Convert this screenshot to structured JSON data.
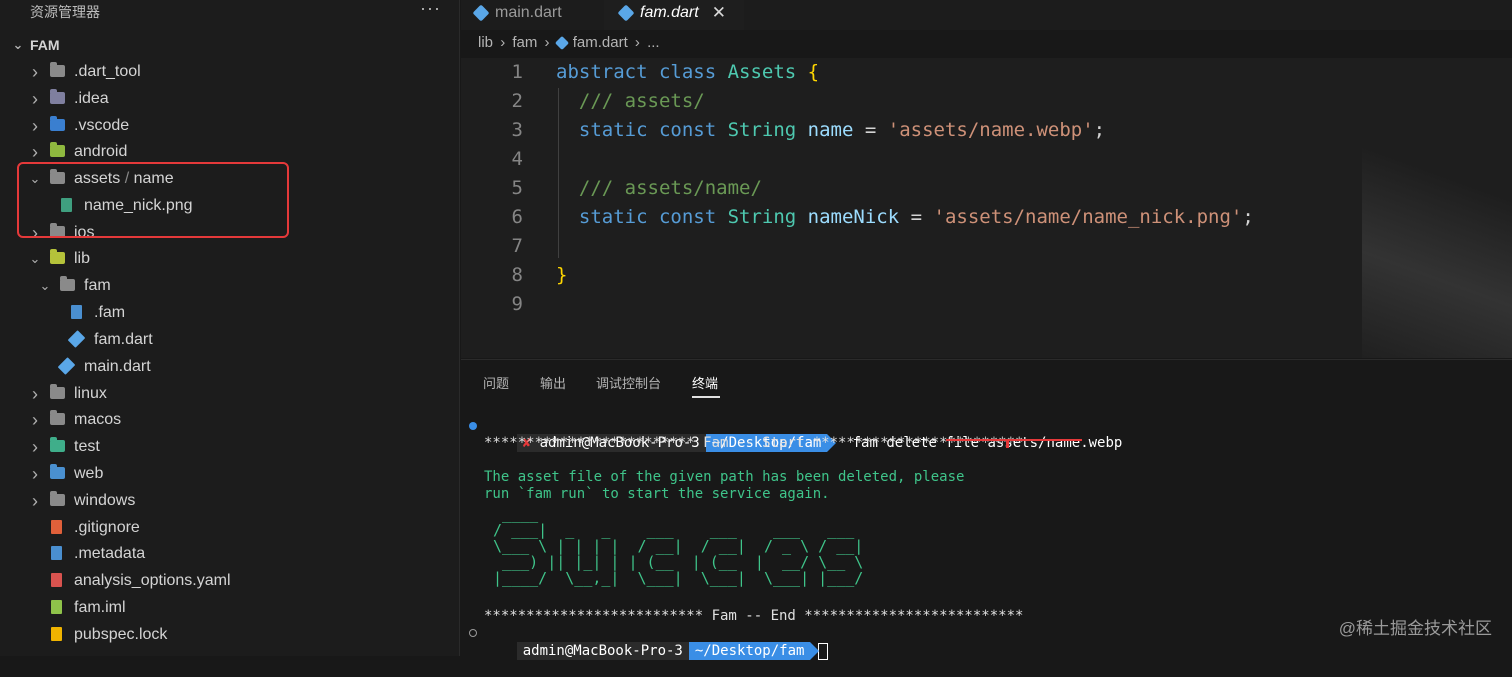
{
  "sidebar": {
    "title": "资源管理器",
    "more": "···",
    "root": "FAM",
    "items": [
      {
        "label": ".dart_tool",
        "chev": "›",
        "icon": "folder-icon",
        "color": "#8a8a8a"
      },
      {
        "label": ".idea",
        "chev": "›",
        "icon": "idea-folder-icon",
        "color": "#7f7f9f"
      },
      {
        "label": ".vscode",
        "chev": "›",
        "icon": "vscode-folder-icon",
        "color": "#3a7fd0"
      },
      {
        "label": "android",
        "chev": "›",
        "icon": "android-folder-icon",
        "color": "#8fb93f"
      },
      {
        "label_a": "assets",
        "label_sep": " / ",
        "label_b": "name",
        "chev": "⌄",
        "icon": "open-folder-icon",
        "color": "#8a8a8a"
      },
      {
        "label": "name_nick.png",
        "icon": "image-file-icon",
        "color": "#3f9f7f"
      },
      {
        "label": "ios",
        "chev": "›",
        "icon": "ios-folder-icon",
        "color": "#8a8a8a"
      },
      {
        "label": "lib",
        "chev": "⌄",
        "icon": "lib-folder-icon",
        "color": "#b5c23a"
      },
      {
        "label": "fam",
        "chev": "⌄",
        "icon": "open-folder-icon",
        "color": "#8a8a8a"
      },
      {
        "label": ".fam",
        "icon": "file-icon",
        "color": "#4a8fd0"
      },
      {
        "label": "fam.dart",
        "icon": "dart-file-icon",
        "color": "#5aa7e8"
      },
      {
        "label": "main.dart",
        "icon": "dart-file-icon",
        "color": "#5aa7e8"
      },
      {
        "label": "linux",
        "chev": "›",
        "icon": "folder-icon",
        "color": "#8a8a8a"
      },
      {
        "label": "macos",
        "chev": "›",
        "icon": "folder-icon",
        "color": "#8a8a8a"
      },
      {
        "label": "test",
        "chev": "›",
        "icon": "test-folder-icon",
        "color": "#3fae8a"
      },
      {
        "label": "web",
        "chev": "›",
        "icon": "web-folder-icon",
        "color": "#4a90d0"
      },
      {
        "label": "windows",
        "chev": "›",
        "icon": "folder-icon",
        "color": "#8a8a8a"
      },
      {
        "label": ".gitignore",
        "icon": "git-file-icon",
        "color": "#e0603a"
      },
      {
        "label": ".metadata",
        "icon": "file-icon",
        "color": "#4a8fd0"
      },
      {
        "label": "analysis_options.yaml",
        "icon": "yaml-file-icon",
        "color": "#d9534f"
      },
      {
        "label": "fam.iml",
        "icon": "iml-file-icon",
        "color": "#8fc34a"
      },
      {
        "label": "pubspec.lock",
        "icon": "lock-file-icon",
        "color": "#f0b400"
      }
    ]
  },
  "tabs": [
    {
      "label": "main.dart",
      "close": ""
    },
    {
      "label": "fam.dart",
      "close": "✕"
    }
  ],
  "breadcrumb": [
    "lib",
    "›",
    "fam",
    "›",
    "fam.dart",
    "›",
    "..."
  ],
  "editor": {
    "lines": [
      {
        "n": "1",
        "parts": [
          [
            "k",
            "abstract "
          ],
          [
            "k",
            "class "
          ],
          [
            "t",
            "Assets "
          ],
          [
            "b",
            "{"
          ]
        ]
      },
      {
        "n": "2",
        "parts": [
          [
            "c",
            "  /// assets/"
          ]
        ]
      },
      {
        "n": "3",
        "parts": [
          [
            "k",
            "  static "
          ],
          [
            "k",
            "const "
          ],
          [
            "t",
            "String "
          ],
          [
            "v",
            "name "
          ],
          [
            "p",
            "= "
          ],
          [
            "s",
            "'assets/name.webp'"
          ],
          [
            "p",
            ";"
          ]
        ]
      },
      {
        "n": "4",
        "parts": []
      },
      {
        "n": "5",
        "parts": [
          [
            "c",
            "  /// assets/name/"
          ]
        ]
      },
      {
        "n": "6",
        "parts": [
          [
            "k",
            "  static "
          ],
          [
            "k",
            "const "
          ],
          [
            "t",
            "String "
          ],
          [
            "v",
            "nameNick "
          ],
          [
            "p",
            "= "
          ],
          [
            "s",
            "'assets/name/name_nick.png'"
          ],
          [
            "p",
            ";"
          ]
        ]
      },
      {
        "n": "7",
        "parts": []
      },
      {
        "n": "8",
        "parts": [
          [
            "b",
            "}"
          ]
        ]
      },
      {
        "n": "9",
        "parts": []
      }
    ]
  },
  "panel": {
    "tabs": [
      "问题",
      "输出",
      "调试控制台",
      "终端"
    ],
    "active_tab": "终端"
  },
  "terminal": {
    "prompt1": {
      "x": "✘",
      "user": "admin@MacBook-Pro-3",
      "path": "~/Desktop/fam",
      "cmd": "fam delete file assets/name.webp"
    },
    "start_line": "************************* Fam -- Start *************************",
    "msg1": "The asset file of the given path has been deleted, please",
    "msg2": "run `fam run` to start the service again.",
    "art": [
      "  ____                                   ",
      " / ___|  _   _    ___    ___    ___   ___ ",
      " \\___ \\ | | | |  / __|  / __|  / _ \\ / __|",
      "  ___) || |_| | | (__  | (__  |  __/ \\__ \\",
      " |____/  \\__,_|  \\___|  \\___|  \\___| |___/"
    ],
    "end_line": "************************** Fam -- End **************************",
    "prompt2": {
      "user": "admin@MacBook-Pro-3",
      "path": "~/Desktop/fam"
    }
  },
  "watermark": "@稀土掘金技术社区"
}
